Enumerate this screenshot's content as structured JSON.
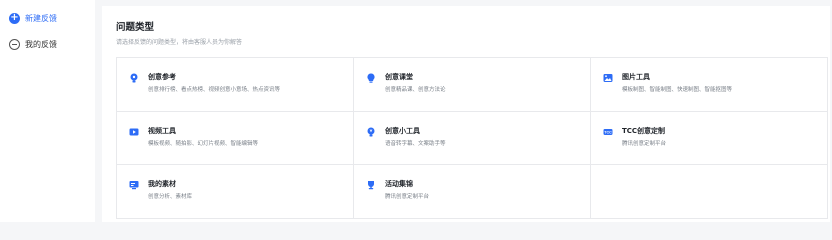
{
  "sidebar": {
    "new_feedback": "新建反馈",
    "my_feedback": "我的反馈"
  },
  "main": {
    "title": "问题类型",
    "subtitle": "请选择反馈的问题类型，将由客服人员为你解答"
  },
  "categories": [
    {
      "name": "创意参考",
      "desc": "创意排行榜、看点热榜、视频创意小意场、热点资讯等",
      "icon": "bulb-icon"
    },
    {
      "name": "创意课堂",
      "desc": "创意精品课、创意方法论",
      "icon": "idea-icon"
    },
    {
      "name": "图片工具",
      "desc": "模板制图、智能制图、快速制图、智能抠图等",
      "icon": "image-icon"
    },
    {
      "name": "视频工具",
      "desc": "模板视频、随拍影、幻灯片视频、智能编辑等",
      "icon": "video-icon"
    },
    {
      "name": "创意小工具",
      "desc": "语音转字幕、文案助手等",
      "icon": "tool-bulb-icon"
    },
    {
      "name": "TCC创意定制",
      "desc": "腾讯创意定制平台",
      "icon": "tcc-icon"
    },
    {
      "name": "我的素材",
      "desc": "创意分析、素材库",
      "icon": "material-icon"
    },
    {
      "name": "活动集锦",
      "desc": "腾讯创意定制平台",
      "icon": "trophy-icon"
    }
  ],
  "colors": {
    "accent": "#2d6cf6"
  }
}
